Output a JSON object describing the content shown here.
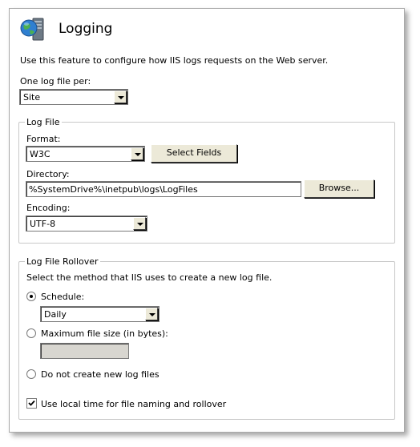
{
  "header": {
    "title": "Logging",
    "icon": "iis-server-globe-icon"
  },
  "description": "Use this feature to configure how IIS logs requests on the Web server.",
  "log_file_per": {
    "label": "One log file per:",
    "value": "Site"
  },
  "log_file": {
    "legend": "Log File",
    "format": {
      "label": "Format:",
      "value": "W3C",
      "select_fields_button": "Select Fields"
    },
    "directory": {
      "label": "Directory:",
      "value": "%SystemDrive%\\inetpub\\logs\\LogFiles",
      "browse_button": "Browse..."
    },
    "encoding": {
      "label": "Encoding:",
      "value": "UTF-8"
    }
  },
  "rollover": {
    "legend": "Log File Rollover",
    "instruction": "Select the method that IIS uses to create a new log file.",
    "schedule": {
      "label": "Schedule:",
      "checked": true,
      "value": "Daily"
    },
    "max_size": {
      "label": "Maximum file size (in bytes):",
      "checked": false,
      "value": ""
    },
    "no_new": {
      "label": "Do not create new log files",
      "checked": false
    },
    "local_time": {
      "label": "Use local time for file naming and rollover",
      "checked": true
    }
  }
}
